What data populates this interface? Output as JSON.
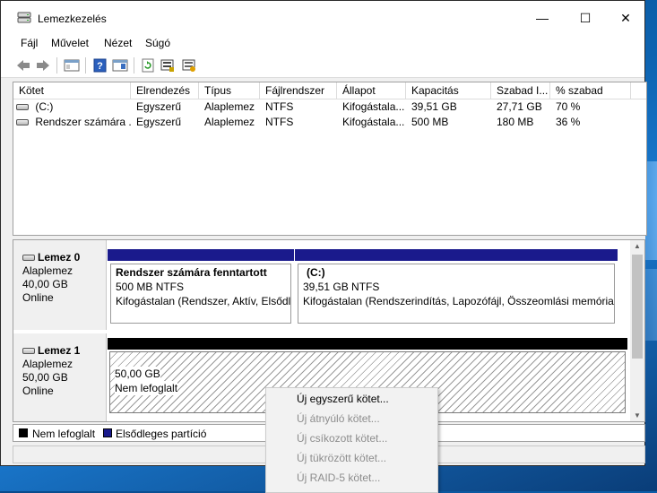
{
  "window": {
    "title": "Lemezkezelés"
  },
  "window_buttons": {
    "minimize": "—",
    "maximize": "☐",
    "close": "✕"
  },
  "menu": [
    "Fájl",
    "Művelet",
    "Nézet",
    "Súgó"
  ],
  "volume_list": {
    "columns": [
      "Kötet",
      "Elrendezés",
      "Típus",
      "Fájlrendszer",
      "Állapot",
      "Kapacitás",
      "Szabad I...",
      "% szabad"
    ],
    "rows": [
      [
        "(C:)",
        "Egyszerű",
        "Alaplemez",
        "NTFS",
        "Kifogástala...",
        "39,51 GB",
        "27,71 GB",
        "70 %"
      ],
      [
        "Rendszer számára ...",
        "Egyszerű",
        "Alaplemez",
        "NTFS",
        "Kifogástala...",
        "500 MB",
        "180 MB",
        "36 %"
      ]
    ]
  },
  "disks": [
    {
      "name": "Lemez 0",
      "type": "Alaplemez",
      "size": "40,00 GB",
      "status": "Online",
      "partitions": [
        {
          "title": "Rendszer számára fenntartott",
          "line1": "500 MB NTFS",
          "line2": "Kifogástalan (Rendszer, Aktív, Elsődle"
        },
        {
          "title": "(C:)",
          "line1": "39,51 GB NTFS",
          "line2": "Kifogástalan (Rendszerindítás, Lapozófájl, Összeomlási memóriakı"
        }
      ]
    },
    {
      "name": "Lemez 1",
      "type": "Alaplemez",
      "size": "50,00 GB",
      "status": "Online",
      "partitions": [
        {
          "line1": "50,00 GB",
          "line2": "Nem lefoglalt"
        }
      ]
    }
  ],
  "legend": [
    {
      "label": "Nem lefoglalt",
      "color": "#000000"
    },
    {
      "label": "Elsődleges partíció",
      "color": "#1a1a8c"
    }
  ],
  "context_menu": [
    {
      "label": "Új egyszerű kötet...",
      "enabled": true
    },
    {
      "label": "Új átnyúló kötet...",
      "enabled": false
    },
    {
      "label": "Új csíkozott kötet...",
      "enabled": false
    },
    {
      "label": "Új tükrözött kötet...",
      "enabled": false
    },
    {
      "label": "Új RAID-5 kötet...",
      "enabled": false
    }
  ],
  "colors": {
    "primary_partition": "#1a1a8c",
    "unallocated": "#000000",
    "accent": "#0a62b4"
  }
}
